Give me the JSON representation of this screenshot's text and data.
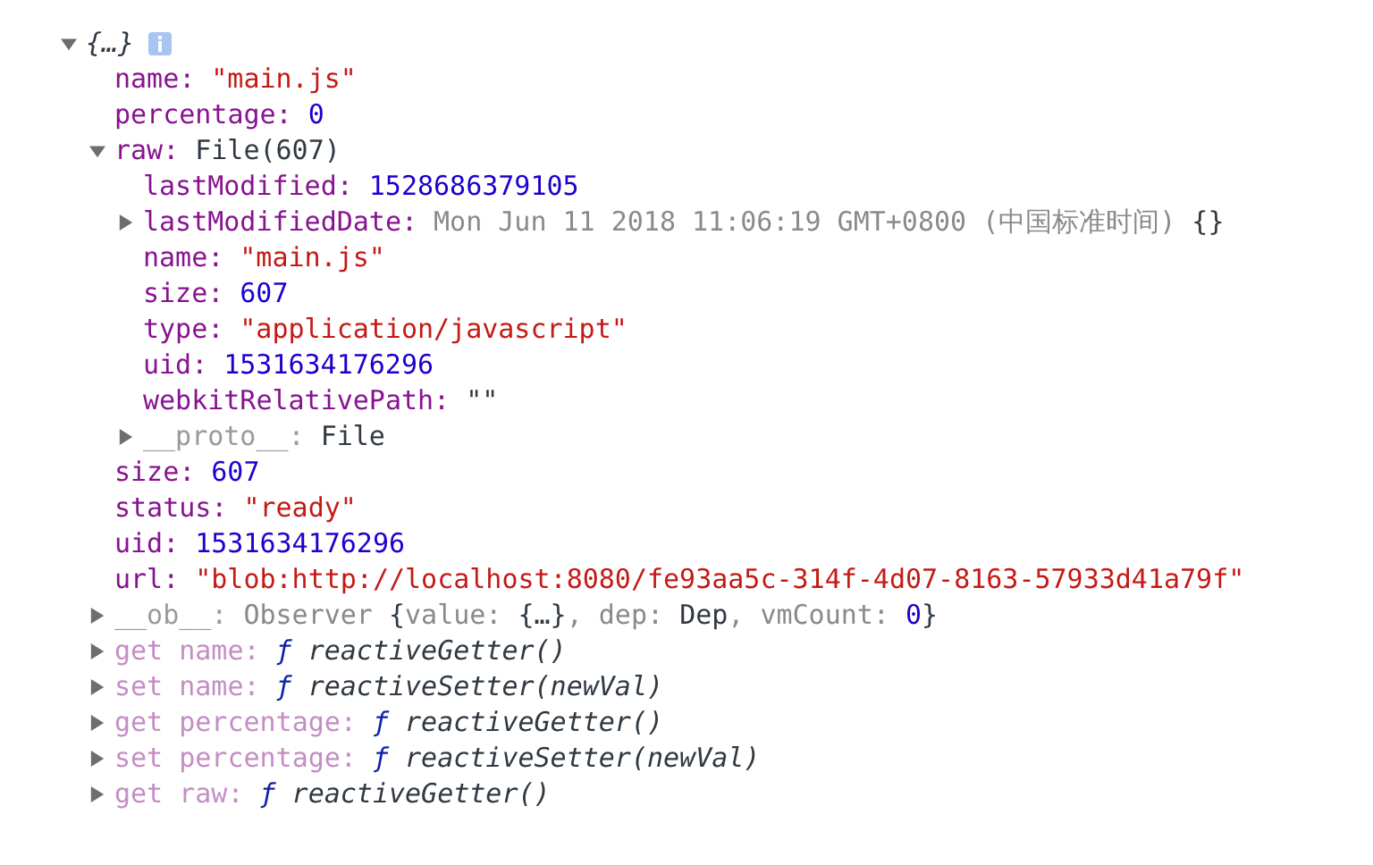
{
  "root": {
    "label": "{…}",
    "expanded": true,
    "children": [
      {
        "key": "name:",
        "kind": "own",
        "value": [
          {
            "kind": "string",
            "text": "\"main.js\""
          }
        ]
      },
      {
        "key": "percentage:",
        "kind": "own",
        "value": [
          {
            "kind": "number",
            "text": "0"
          }
        ]
      },
      {
        "key": "raw:",
        "kind": "own",
        "expanded": true,
        "value": [
          {
            "kind": "plain",
            "text": "File(607)"
          }
        ],
        "children": [
          {
            "key": "lastModified:",
            "kind": "own",
            "value": [
              {
                "kind": "number",
                "text": "1528686379105"
              }
            ]
          },
          {
            "key": "lastModifiedDate:",
            "kind": "own",
            "expanded": false,
            "value": [
              {
                "kind": "dim",
                "text": "Mon Jun 11 2018 11:06:19 GMT+0800 (中国标准时间)"
              },
              {
                "kind": "plain",
                "text": " {}"
              }
            ]
          },
          {
            "key": "name:",
            "kind": "own",
            "value": [
              {
                "kind": "string",
                "text": "\"main.js\""
              }
            ]
          },
          {
            "key": "size:",
            "kind": "own",
            "value": [
              {
                "kind": "number",
                "text": "607"
              }
            ]
          },
          {
            "key": "type:",
            "kind": "own",
            "value": [
              {
                "kind": "string",
                "text": "\"application/javascript\""
              }
            ]
          },
          {
            "key": "uid:",
            "kind": "own",
            "value": [
              {
                "kind": "number",
                "text": "1531634176296"
              }
            ]
          },
          {
            "key": "webkitRelativePath:",
            "kind": "own",
            "value": [
              {
                "kind": "plain",
                "text": "\"\""
              }
            ]
          },
          {
            "key": "__proto__:",
            "kind": "internal",
            "expanded": false,
            "value": [
              {
                "kind": "plain",
                "text": "File"
              }
            ]
          }
        ]
      },
      {
        "key": "size:",
        "kind": "own",
        "value": [
          {
            "kind": "number",
            "text": "607"
          }
        ]
      },
      {
        "key": "status:",
        "kind": "own",
        "value": [
          {
            "kind": "string",
            "text": "\"ready\""
          }
        ]
      },
      {
        "key": "uid:",
        "kind": "own",
        "value": [
          {
            "kind": "number",
            "text": "1531634176296"
          }
        ]
      },
      {
        "key": "url:",
        "kind": "own",
        "value": [
          {
            "kind": "string",
            "text": "\"blob:http://localhost:8080/fe93aa5c-314f-4d07-8163-57933d41a79f\""
          }
        ]
      },
      {
        "key": "__ob__:",
        "kind": "internal",
        "expanded": false,
        "value": [
          {
            "kind": "dim",
            "text": "Observer "
          },
          {
            "kind": "plain",
            "text": "{"
          },
          {
            "kind": "dim",
            "text": "value: "
          },
          {
            "kind": "plain",
            "text": "{…}"
          },
          {
            "kind": "dim",
            "text": ", dep: "
          },
          {
            "kind": "plain",
            "text": "Dep"
          },
          {
            "kind": "dim",
            "text": ", vmCount: "
          },
          {
            "kind": "number",
            "text": "0"
          },
          {
            "kind": "plain",
            "text": "}"
          }
        ]
      },
      {
        "key": "get name:",
        "kind": "accessor",
        "expanded": false,
        "value": [
          {
            "kind": "fn_mark",
            "text": "ƒ"
          },
          {
            "kind": "fn_name",
            "text": " reactiveGetter()"
          }
        ]
      },
      {
        "key": "set name:",
        "kind": "accessor",
        "expanded": false,
        "value": [
          {
            "kind": "fn_mark",
            "text": "ƒ"
          },
          {
            "kind": "fn_name",
            "text": " reactiveSetter(newVal)"
          }
        ]
      },
      {
        "key": "get percentage:",
        "kind": "accessor",
        "expanded": false,
        "value": [
          {
            "kind": "fn_mark",
            "text": "ƒ"
          },
          {
            "kind": "fn_name",
            "text": " reactiveGetter()"
          }
        ]
      },
      {
        "key": "set percentage:",
        "kind": "accessor",
        "expanded": false,
        "value": [
          {
            "kind": "fn_mark",
            "text": "ƒ"
          },
          {
            "kind": "fn_name",
            "text": " reactiveSetter(newVal)"
          }
        ]
      },
      {
        "key": "get raw:",
        "kind": "accessor",
        "expanded": false,
        "value": [
          {
            "kind": "fn_mark",
            "text": "ƒ"
          },
          {
            "kind": "fn_name",
            "text": " reactiveGetter()"
          }
        ]
      }
    ]
  }
}
